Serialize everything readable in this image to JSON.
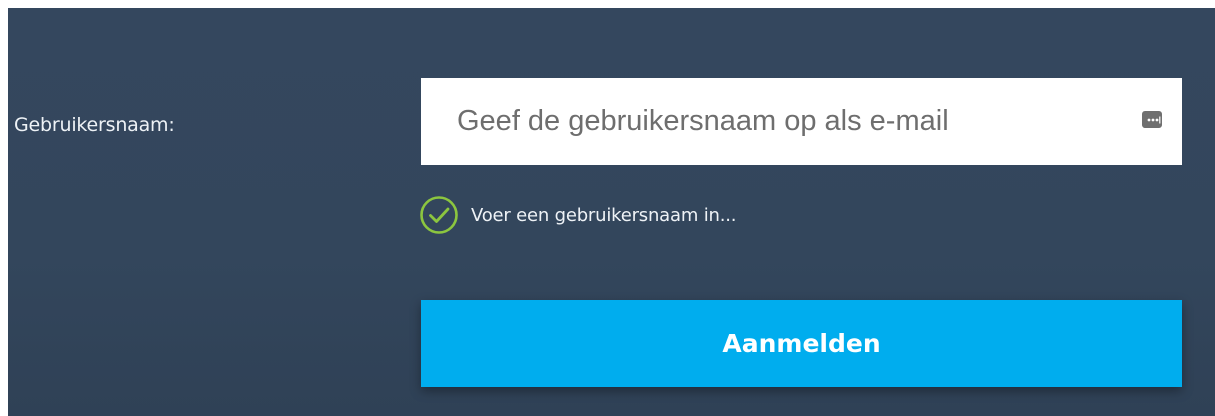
{
  "login_form": {
    "username_label": "Gebruikersnaam:",
    "username_value": "",
    "username_placeholder": "Geef de gebruikersnaam op als e-mail",
    "password_manager_icon": "password-manager-icon",
    "validation_icon": "check-circle-icon",
    "validation_message": "Voer een gebruikersnaam in...",
    "submit_label": "Aanmelden"
  },
  "colors": {
    "panel_background": "#34475e",
    "accent_button": "#00adee",
    "validation_check": "#8cc63f",
    "input_background": "#ffffff",
    "label_text": "#eef2f6"
  }
}
